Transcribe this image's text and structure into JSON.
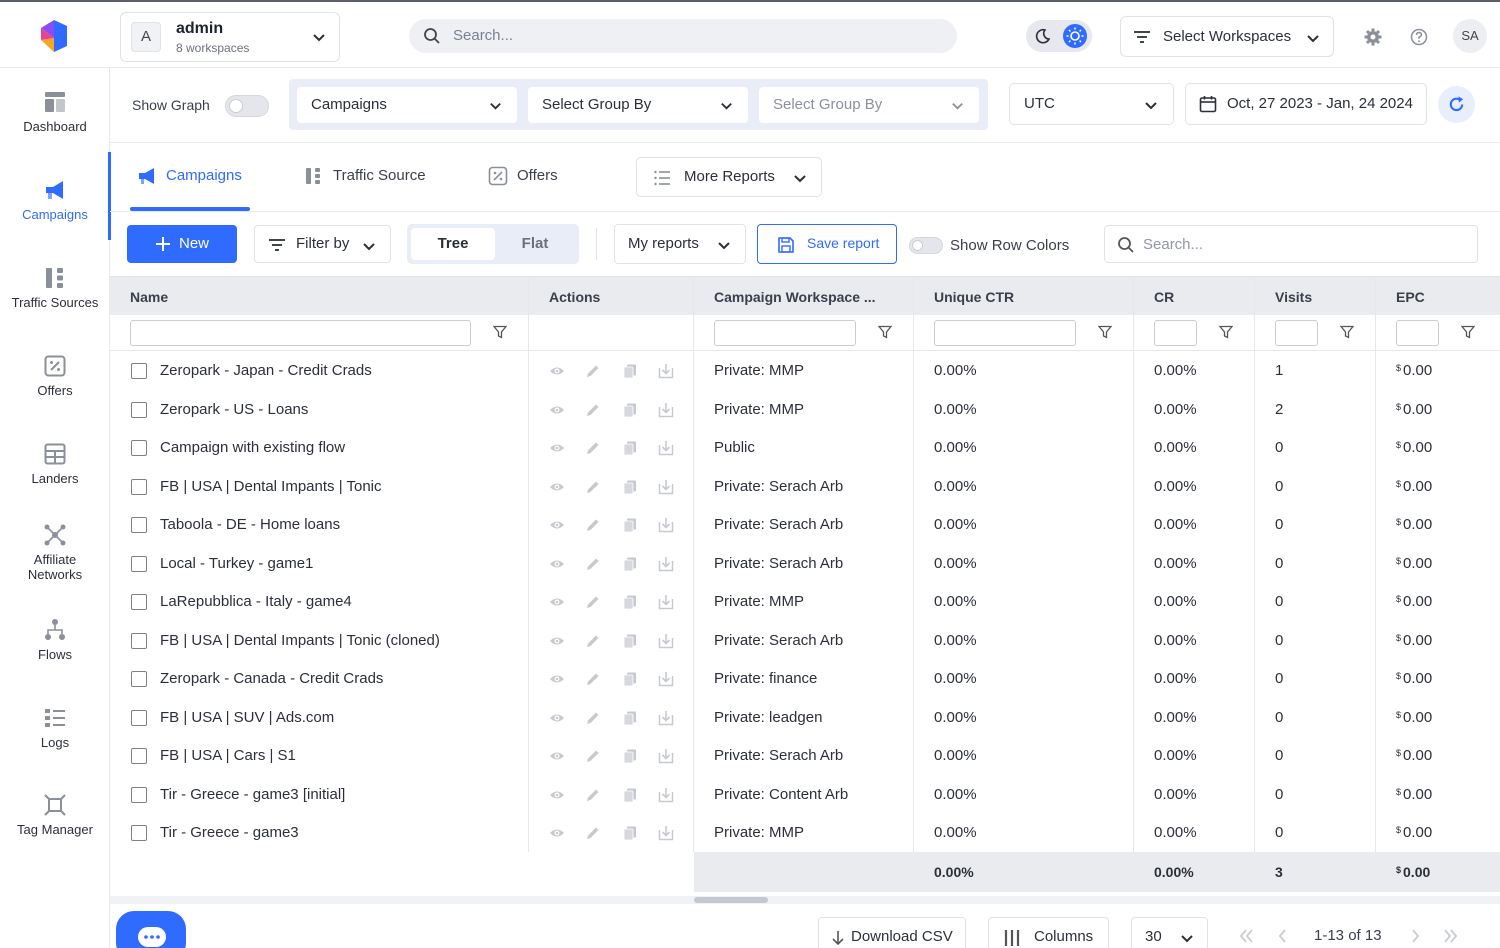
{
  "workspace": {
    "avatar": "A",
    "name": "admin",
    "subtitle": "8 workspaces"
  },
  "top_search": {
    "placeholder": "Search..."
  },
  "workspace_select": {
    "label": "Select Workspaces"
  },
  "user": {
    "initials": "SA"
  },
  "sidebar": {
    "items": [
      {
        "label": "Dashboard",
        "icon": "dashboard-icon"
      },
      {
        "label": "Campaigns",
        "icon": "megaphone-icon",
        "active": true
      },
      {
        "label": "Traffic Sources",
        "icon": "traffic-sources-icon"
      },
      {
        "label": "Offers",
        "icon": "offers-icon"
      },
      {
        "label": "Landers",
        "icon": "landers-icon"
      },
      {
        "label": "Affiliate",
        "label2": "Networks",
        "icon": "network-icon"
      },
      {
        "label": "Flows",
        "icon": "flows-icon"
      },
      {
        "label": "Logs",
        "icon": "logs-icon"
      },
      {
        "label": "Tag Manager",
        "icon": "tag-manager-icon"
      }
    ]
  },
  "filters": {
    "show_graph_label": "Show Graph",
    "group1": "Campaigns",
    "group2": "Select Group By",
    "group3": "Select Group By",
    "timezone": "UTC",
    "date_range": "Oct, 27 2023 - Jan, 24 2024"
  },
  "tabs": {
    "campaigns": "Campaigns",
    "traffic_source": "Traffic Source",
    "offers": "Offers",
    "more_reports": "More Reports"
  },
  "toolbar": {
    "new_label": "New",
    "filter_label": "Filter by",
    "tree_label": "Tree",
    "flat_label": "Flat",
    "my_reports_label": "My reports",
    "save_report_label": "Save report",
    "row_colors_label": "Show Row Colors",
    "search_placeholder": "Search..."
  },
  "table": {
    "headers": {
      "name": "Name",
      "actions": "Actions",
      "workspace": "Campaign Workspace ...",
      "ctr": "Unique CTR",
      "cr": "CR",
      "visits": "Visits",
      "epc": "EPC"
    },
    "rows": [
      {
        "name": "Zeropark - Japan - Credit Crads",
        "workspace": "Private: MMP",
        "ctr": "0.00%",
        "cr": "0.00%",
        "visits": "1",
        "epc": "0.00"
      },
      {
        "name": "Zeropark - US - Loans",
        "workspace": "Private: MMP",
        "ctr": "0.00%",
        "cr": "0.00%",
        "visits": "2",
        "epc": "0.00"
      },
      {
        "name": "Campaign with existing flow",
        "workspace": "Public",
        "ctr": "0.00%",
        "cr": "0.00%",
        "visits": "0",
        "epc": "0.00"
      },
      {
        "name": "FB | USA | Dental Impants | Tonic",
        "workspace": "Private: Serach Arb",
        "ctr": "0.00%",
        "cr": "0.00%",
        "visits": "0",
        "epc": "0.00"
      },
      {
        "name": "Taboola - DE - Home loans",
        "workspace": "Private: Serach Arb",
        "ctr": "0.00%",
        "cr": "0.00%",
        "visits": "0",
        "epc": "0.00"
      },
      {
        "name": "Local - Turkey - game1",
        "workspace": "Private: Serach Arb",
        "ctr": "0.00%",
        "cr": "0.00%",
        "visits": "0",
        "epc": "0.00"
      },
      {
        "name": "LaRepubblica - Italy - game4",
        "workspace": "Private: MMP",
        "ctr": "0.00%",
        "cr": "0.00%",
        "visits": "0",
        "epc": "0.00"
      },
      {
        "name": "FB | USA | Dental Impants | Tonic (cloned)",
        "workspace": "Private: Serach Arb",
        "ctr": "0.00%",
        "cr": "0.00%",
        "visits": "0",
        "epc": "0.00"
      },
      {
        "name": "Zeropark - Canada - Credit Crads",
        "workspace": "Private: finance",
        "ctr": "0.00%",
        "cr": "0.00%",
        "visits": "0",
        "epc": "0.00"
      },
      {
        "name": "FB | USA | SUV | Ads.com",
        "workspace": "Private: leadgen",
        "ctr": "0.00%",
        "cr": "0.00%",
        "visits": "0",
        "epc": "0.00"
      },
      {
        "name": "FB | USA | Cars | S1",
        "workspace": "Private: Serach Arb",
        "ctr": "0.00%",
        "cr": "0.00%",
        "visits": "0",
        "epc": "0.00"
      },
      {
        "name": "Tir - Greece - game3 [initial]",
        "workspace": "Private: Content Arb",
        "ctr": "0.00%",
        "cr": "0.00%",
        "visits": "0",
        "epc": "0.00"
      },
      {
        "name": "Tir - Greece - game3",
        "workspace": "Private: MMP",
        "ctr": "0.00%",
        "cr": "0.00%",
        "visits": "0",
        "epc": "0.00"
      }
    ],
    "currency_symbol": "$",
    "totals": {
      "ctr": "0.00%",
      "cr": "0.00%",
      "visits": "3",
      "epc": "0.00"
    }
  },
  "bottom": {
    "download_csv": "Download CSV",
    "columns": "Columns",
    "page_size": "30",
    "page_info": "1-13 of 13"
  },
  "colors": {
    "accent": "#2f6bff",
    "header_bg": "#e9ebef"
  }
}
